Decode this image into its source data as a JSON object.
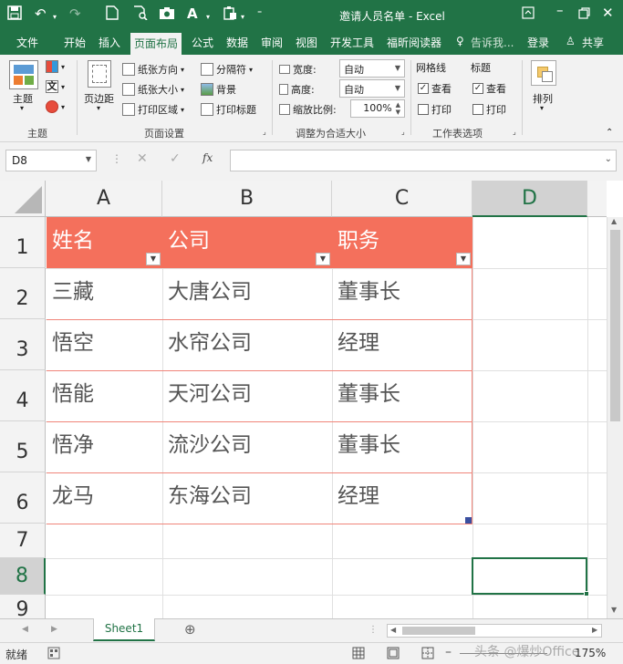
{
  "window": {
    "title": "邀请人员名单 - Excel"
  },
  "tabs": [
    "文件",
    "开始",
    "插入",
    "页面布局",
    "公式",
    "数据",
    "审阅",
    "视图",
    "开发工具",
    "福昕阅读器",
    "告诉我...",
    "登录",
    "共享"
  ],
  "active_tab": "页面布局",
  "ribbon": {
    "theme": {
      "theme_label": "主题",
      "group_label": "主题"
    },
    "page_setup": {
      "margins_label": "页边距",
      "orientation_label": "纸张方向",
      "size_label": "纸张大小",
      "print_area_label": "打印区域",
      "breaks_label": "分隔符",
      "background_label": "背景",
      "print_titles_label": "打印标题",
      "group_label": "页面设置"
    },
    "scale": {
      "width_label": "宽度:",
      "width_value": "自动",
      "height_label": "高度:",
      "height_value": "自动",
      "scale_label": "缩放比例:",
      "scale_value": "100%",
      "group_label": "调整为合适大小"
    },
    "sheet_options": {
      "gridlines_label": "网格线",
      "headings_label": "标题",
      "view_label": "查看",
      "print_label": "打印",
      "group_label": "工作表选项"
    },
    "arrange": {
      "arrange_label": "排列"
    }
  },
  "formula_bar": {
    "name_box": "D8",
    "fx": "fx",
    "value": ""
  },
  "columns": [
    "A",
    "B",
    "C",
    "D"
  ],
  "rows": [
    "1",
    "2",
    "3",
    "4",
    "5",
    "6",
    "7",
    "8",
    "9"
  ],
  "table": {
    "headers": [
      "姓名",
      "公司",
      "职务"
    ],
    "data": [
      [
        "三藏",
        "大唐公司",
        "董事长"
      ],
      [
        "悟空",
        "水帘公司",
        "经理"
      ],
      [
        "悟能",
        "天河公司",
        "董事长"
      ],
      [
        "悟净",
        "流沙公司",
        "董事长"
      ],
      [
        "龙马",
        "东海公司",
        "经理"
      ]
    ]
  },
  "sheet_tabs": [
    "Sheet1"
  ],
  "status": {
    "ready": "就绪",
    "zoom": "175%",
    "watermark": "头条 @爆炒Office"
  },
  "colors": {
    "excel_green": "#217346",
    "header_fill": "#f4705c",
    "selection": "#217346"
  }
}
